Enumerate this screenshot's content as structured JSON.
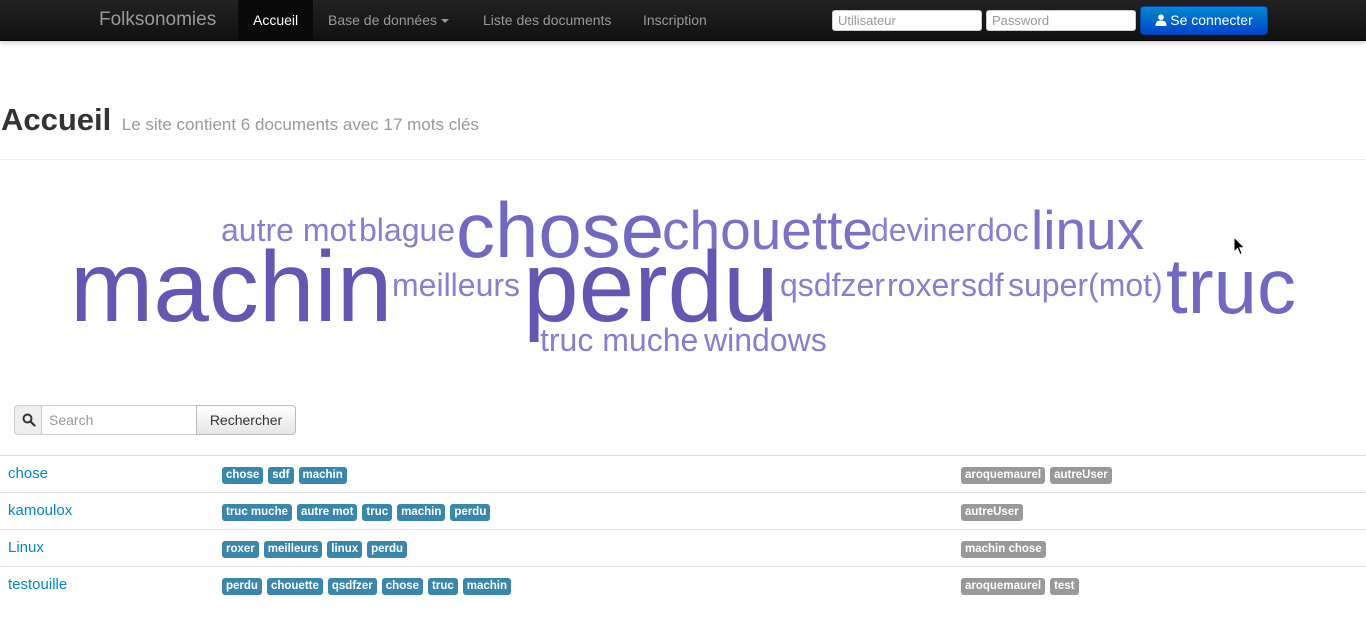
{
  "navbar": {
    "brand": "Folksonomies",
    "items": [
      {
        "label": "Accueil",
        "active": true
      },
      {
        "label": "Base de données",
        "dropdown": true
      },
      {
        "label": "Liste des documents"
      },
      {
        "label": "Inscription"
      }
    ],
    "username_placeholder": "Utilisateur",
    "password_placeholder": "Password",
    "login_label": "Se connecter"
  },
  "header": {
    "title": "Accueil",
    "subtitle": "Le site contient 6 documents avec 17 mots clés"
  },
  "tag_cloud": {
    "words": [
      {
        "text": "autre mot",
        "weight": 2
      },
      {
        "text": "blague",
        "weight": 2
      },
      {
        "text": "chose",
        "weight": 5
      },
      {
        "text": "chouette",
        "weight": 4
      },
      {
        "text": "deviner",
        "weight": 2
      },
      {
        "text": "doc",
        "weight": 2
      },
      {
        "text": "linux",
        "weight": 4
      },
      {
        "text": "machin",
        "weight": 7
      },
      {
        "text": "meilleurs",
        "weight": 2
      },
      {
        "text": "perdu",
        "weight": 7
      },
      {
        "text": "qsdfzer",
        "weight": 2
      },
      {
        "text": "roxer",
        "weight": 2
      },
      {
        "text": "sdf",
        "weight": 2
      },
      {
        "text": "super(mot)",
        "weight": 2
      },
      {
        "text": "truc",
        "weight": 5
      },
      {
        "text": "truc muche",
        "weight": 2
      },
      {
        "text": "windows",
        "weight": 2
      }
    ],
    "colors": {
      "light": "#8a7fce",
      "dark": "#6357b3"
    }
  },
  "search": {
    "placeholder": "Search",
    "button_label": "Rechercher"
  },
  "documents": [
    {
      "title": "chose",
      "tags": [
        "chose",
        "sdf",
        "machin"
      ],
      "users": [
        "aroquemaurel",
        "autreUser"
      ]
    },
    {
      "title": "kamoulox",
      "tags": [
        "truc muche",
        "autre mot",
        "truc",
        "machin",
        "perdu"
      ],
      "users": [
        "autreUser"
      ]
    },
    {
      "title": "Linux",
      "tags": [
        "roxer",
        "meilleurs",
        "linux",
        "perdu"
      ],
      "users": [
        "machin chose"
      ]
    },
    {
      "title": "testouille",
      "tags": [
        "perdu",
        "chouette",
        "qsdfzer",
        "chose",
        "truc",
        "machin"
      ],
      "users": [
        "aroquemaurel",
        "test"
      ]
    }
  ],
  "colors": {
    "tag": "#3a87ad",
    "user_label": "#999999",
    "link": "#0088cc",
    "primary_button": "#0055cc"
  }
}
